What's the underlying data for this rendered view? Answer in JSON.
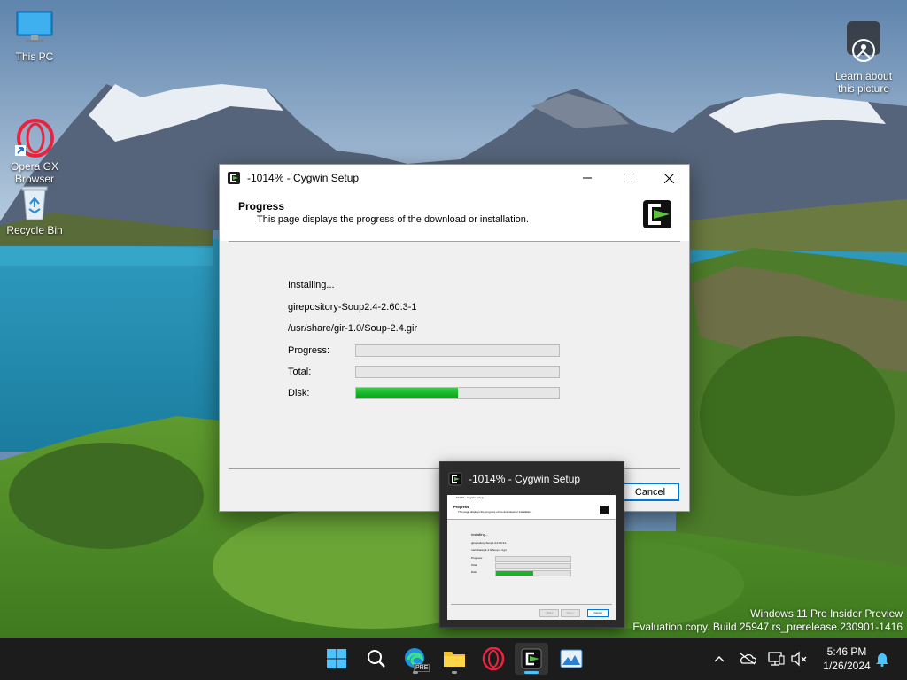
{
  "desktop": {
    "icons": [
      {
        "label": "This PC",
        "icon": "monitor-icon"
      },
      {
        "label": "Opera GX\nBrowser",
        "icon": "opera-gx-icon"
      },
      {
        "label": "Recycle Bin",
        "icon": "recycle-bin-icon"
      }
    ],
    "learn_about": "Learn about\nthis picture"
  },
  "window": {
    "title": "-1014% - Cygwin Setup",
    "header_title": "Progress",
    "header_subtitle": "This page displays the progress of the download or installation.",
    "status": "Installing...",
    "package": "girepository-Soup2.4-2.60.3-1",
    "file": "/usr/share/gir-1.0/Soup-2.4.gir",
    "labels": {
      "progress": "Progress:",
      "total": "Total:",
      "disk": "Disk:"
    },
    "progress_values": {
      "progress": 0,
      "total": 0,
      "disk": 0.5
    },
    "cancel_label": "Cancel",
    "accent": "#0078d7",
    "bar_color": "#12b324"
  },
  "preview": {
    "title": "-1014% - Cygwin Setup",
    "mini": {
      "title": "-1014% - Cygwin Setup",
      "header_title": "Progress",
      "header_subtitle": "This page displays the progress of the download or installation.",
      "status": "Installing...",
      "package": "girepository-Soup2.4-2.60.3-1",
      "file": "/usr/share/gir-1.0/Soup-2.4.gir",
      "progress_label": "Progress:",
      "total_label": "Total:",
      "disk_label": "Disk:",
      "back_label": "< Back",
      "next_label": "Next >",
      "cancel_label": "Cancel"
    }
  },
  "watermark": {
    "line1": "Windows 11 Pro Insider Preview",
    "line2": "Evaluation copy. Build 25947.rs_prerelease.230901-1416"
  },
  "taskbar": {
    "apps": [
      "start-icon",
      "search-icon",
      "edge-beta-icon",
      "file-explorer-icon",
      "opera-gx-icon",
      "cygwin-setup-icon",
      "photos-icon"
    ],
    "edge_badge": "PRE",
    "tray": [
      "chevron-up-icon",
      "onedrive-icon",
      "network-icon",
      "volume-muted-icon",
      "notification-bell-icon"
    ],
    "time": "5:46 PM",
    "date": "1/26/2024"
  }
}
